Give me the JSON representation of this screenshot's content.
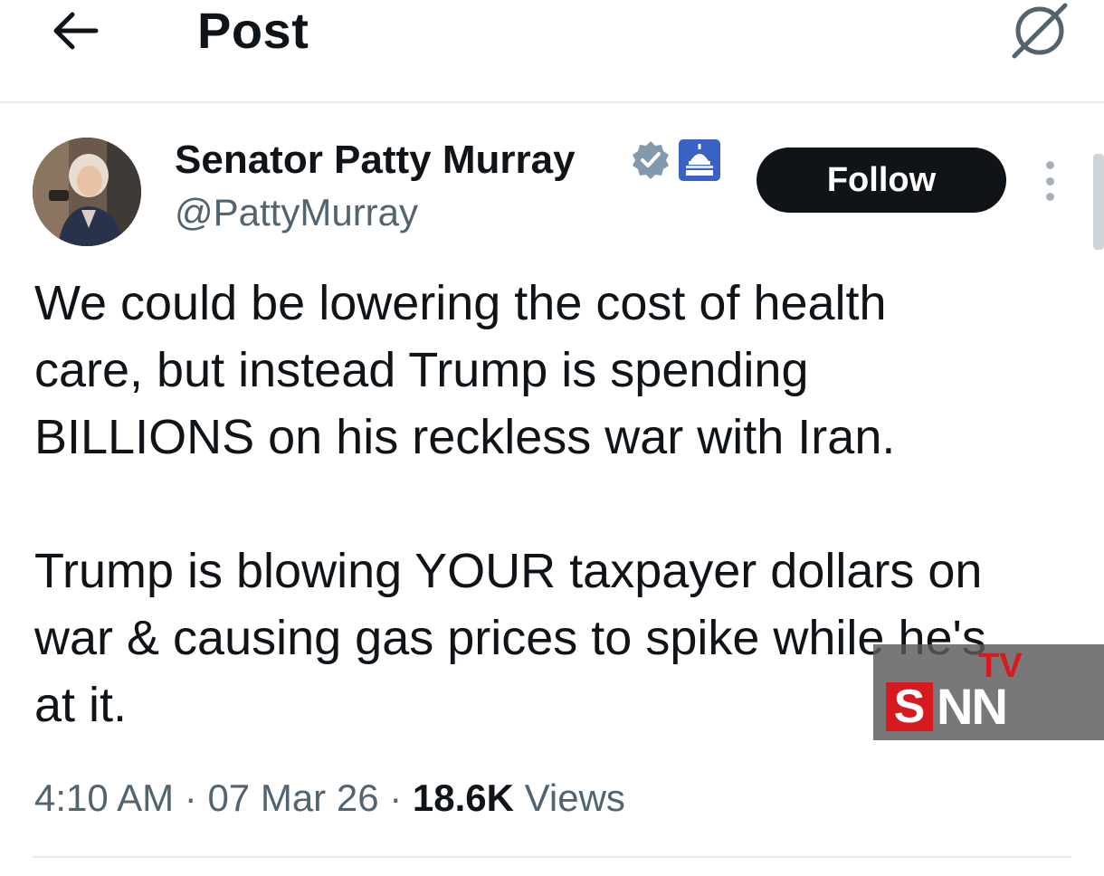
{
  "header": {
    "back_icon": "arrow-left-icon",
    "title": "Post",
    "grok_icon": "grok-slash-icon"
  },
  "author": {
    "name": "Senator Patty Murray",
    "handle": "@PattyMurray",
    "verified_icon": "verified-badge-icon",
    "affiliation_icon": "capitol-dome-icon",
    "follow_label": "Follow",
    "more_icon": "more-vertical-icon"
  },
  "tweet": {
    "paragraphs": [
      "We could be lowering the cost of health\ncare, but instead Trump is spending\nBILLIONS on his reckless war with Iran.",
      "Trump is blowing YOUR taxpayer dollars on\nwar & causing gas prices to spike while he's\nat it."
    ]
  },
  "meta": {
    "time": "4:10 AM",
    "separator": "·",
    "date": "07 Mar 26",
    "views_count": "18.6K",
    "views_label": "Views"
  },
  "watermark": {
    "letter_s": "S",
    "letters_nn": "NN",
    "tv": "TV"
  },
  "colors": {
    "text_primary": "#0f1419",
    "text_secondary": "#536471",
    "follow_bg": "#0f1419",
    "verified_badge": "#829aab",
    "affiliation_badge": "#3a62c4",
    "watermark_red": "#d71920",
    "divider": "#e6ecf0"
  }
}
